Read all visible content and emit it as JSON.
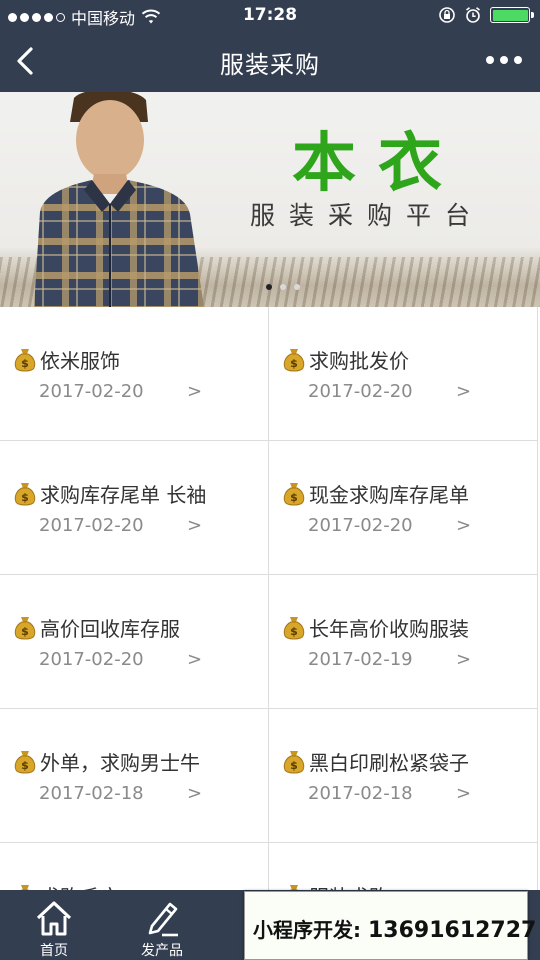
{
  "status": {
    "carrier": "中国移动",
    "time": "17:28",
    "signal_filled": 4,
    "signal_total": 5,
    "battery_level": 1.0
  },
  "nav": {
    "title": "服装采购",
    "back_icon": "chevron-left-icon",
    "more_icon": "more-dots-icon"
  },
  "banner": {
    "brand": "本衣",
    "subtitle": "服装采购平台",
    "slide_count": 3,
    "active_slide": 1
  },
  "items": [
    {
      "title": "依米服饰",
      "date": "2017-02-20",
      "arrow": ">"
    },
    {
      "title": "求购批发价",
      "date": "2017-02-20",
      "arrow": ">"
    },
    {
      "title": "求购库存尾单 长袖",
      "date": "2017-02-20",
      "arrow": ">"
    },
    {
      "title": "现金求购库存尾单",
      "date": "2017-02-20",
      "arrow": ">"
    },
    {
      "title": "高价回收库存服",
      "date": "2017-02-20",
      "arrow": ">"
    },
    {
      "title": "长年高价收购服装",
      "date": "2017-02-19",
      "arrow": ">"
    },
    {
      "title": "外单，求购男士牛",
      "date": "2017-02-18",
      "arrow": ">"
    },
    {
      "title": "黑白印刷松紧袋子",
      "date": "2017-02-18",
      "arrow": ">"
    },
    {
      "title": "求购毛衣",
      "date": "",
      "arrow": ""
    },
    {
      "title": "服装求购",
      "date": "",
      "arrow": ""
    }
  ],
  "tabs": [
    {
      "label": "首页",
      "icon": "home-icon"
    },
    {
      "label": "发产品",
      "icon": "edit-icon"
    }
  ],
  "promo": {
    "label": "小程序开发:",
    "phone": "13691612727"
  },
  "colors": {
    "bar": "#333e50",
    "brand_green": "#2fa51c",
    "divider": "#dcdcdc",
    "date_gray": "#8a8a8a"
  }
}
